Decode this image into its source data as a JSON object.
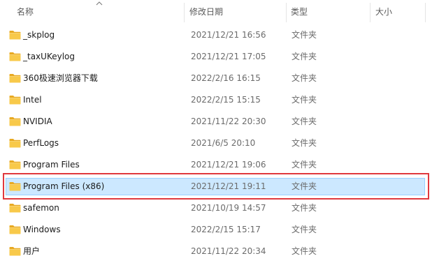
{
  "header": {
    "name_label": "名称",
    "date_label": "修改日期",
    "type_label": "类型",
    "size_label": "大小",
    "sort_icon": "chevron-up-icon"
  },
  "colors": {
    "selection_bg": "#cce8ff",
    "selection_border": "#99d1ff",
    "highlight_box": "#e0393e",
    "folder_yellow": "#f5c243"
  },
  "rows": [
    {
      "name": "_skplog",
      "date": "2021/12/21 16:56",
      "type": "文件夹",
      "size": "",
      "icon": "folder-icon"
    },
    {
      "name": "_taxUKeylog",
      "date": "2021/12/21 17:05",
      "type": "文件夹",
      "size": "",
      "icon": "folder-icon"
    },
    {
      "name": "360极速浏览器下载",
      "date": "2022/2/16 16:15",
      "type": "文件夹",
      "size": "",
      "icon": "folder-icon"
    },
    {
      "name": "Intel",
      "date": "2022/2/15 15:15",
      "type": "文件夹",
      "size": "",
      "icon": "folder-icon"
    },
    {
      "name": "NVIDIA",
      "date": "2021/11/22 20:30",
      "type": "文件夹",
      "size": "",
      "icon": "folder-icon"
    },
    {
      "name": "PerfLogs",
      "date": "2021/6/5 20:10",
      "type": "文件夹",
      "size": "",
      "icon": "folder-icon"
    },
    {
      "name": "Program Files",
      "date": "2021/12/21 19:06",
      "type": "文件夹",
      "size": "",
      "icon": "folder-icon"
    },
    {
      "name": "Program Files (x86)",
      "date": "2021/12/21 19:11",
      "type": "文件夹",
      "size": "",
      "icon": "folder-icon",
      "selected": true
    },
    {
      "name": "safemon",
      "date": "2021/10/19 14:57",
      "type": "文件夹",
      "size": "",
      "icon": "folder-icon"
    },
    {
      "name": "Windows",
      "date": "2022/2/15 15:17",
      "type": "文件夹",
      "size": "",
      "icon": "folder-icon"
    },
    {
      "name": "用户",
      "date": "2021/11/22 20:34",
      "type": "文件夹",
      "size": "",
      "icon": "folder-icon"
    }
  ]
}
